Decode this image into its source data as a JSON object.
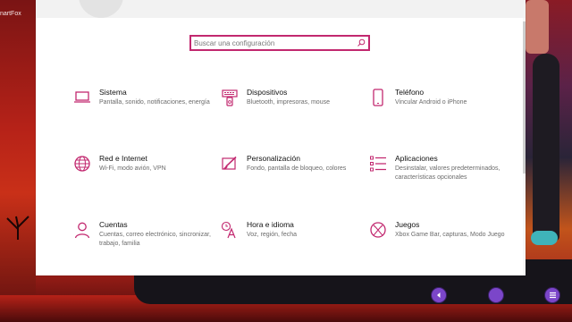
{
  "desktop": {
    "left_label": "nartFox"
  },
  "settings": {
    "search": {
      "placeholder": "Buscar una configuración"
    },
    "accent_color": "#c2286f",
    "tiles": [
      {
        "title": "Sistema",
        "desc": "Pantalla, sonido, notificaciones, energía",
        "icon": "laptop-icon"
      },
      {
        "title": "Dispositivos",
        "desc": "Bluetooth, impresoras, mouse",
        "icon": "devices-icon"
      },
      {
        "title": "Teléfono",
        "desc": "Vincular Android o iPhone",
        "icon": "phone-icon"
      },
      {
        "title": "Red e Internet",
        "desc": "Wi-Fi, modo avión, VPN",
        "icon": "globe-icon"
      },
      {
        "title": "Personalización",
        "desc": "Fondo, pantalla de bloqueo, colores",
        "icon": "paint-icon"
      },
      {
        "title": "Aplicaciones",
        "desc": "Desinstalar, valores predeterminados, características opcionales",
        "icon": "apps-list-icon"
      },
      {
        "title": "Cuentas",
        "desc": "Cuentas, correo electrónico, sincronizar, trabajo, familia",
        "icon": "person-icon"
      },
      {
        "title": "Hora e idioma",
        "desc": "Voz, región, fecha",
        "icon": "time-language-icon"
      },
      {
        "title": "Juegos",
        "desc": "Xbox Game Bar, capturas, Modo Juego",
        "icon": "xbox-icon"
      }
    ]
  },
  "taskbar_overlay": {
    "icons": [
      "back-icon",
      "circle-icon",
      "list-icon"
    ]
  }
}
